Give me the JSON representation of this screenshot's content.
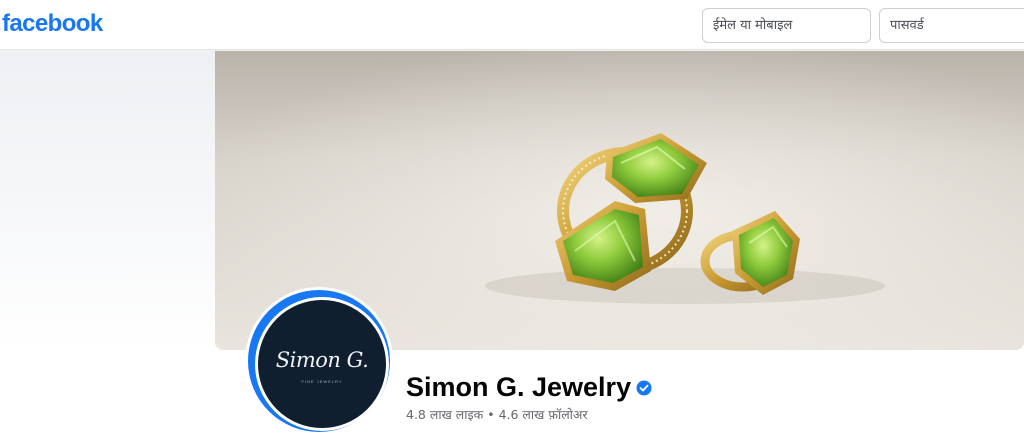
{
  "header": {
    "logo_text": "facebook",
    "email_placeholder": "ईमेल या मोबाइल",
    "password_placeholder": "पासवर्ड"
  },
  "page": {
    "name": "Simon G. Jewelry",
    "avatar_logo": "Simon G.",
    "avatar_tagline": "FINE JEWELRY",
    "likes": "4.8 लाख लाइक",
    "separator": "•",
    "followers": "4.6 लाख फ़ॉलोअर",
    "verified_icon": "verified-badge-icon"
  },
  "colors": {
    "brand": "#1877f2",
    "text_primary": "#050505",
    "text_secondary": "#65676b",
    "avatar_bg": "#0f1f2f",
    "gem": "#7cc23a"
  }
}
